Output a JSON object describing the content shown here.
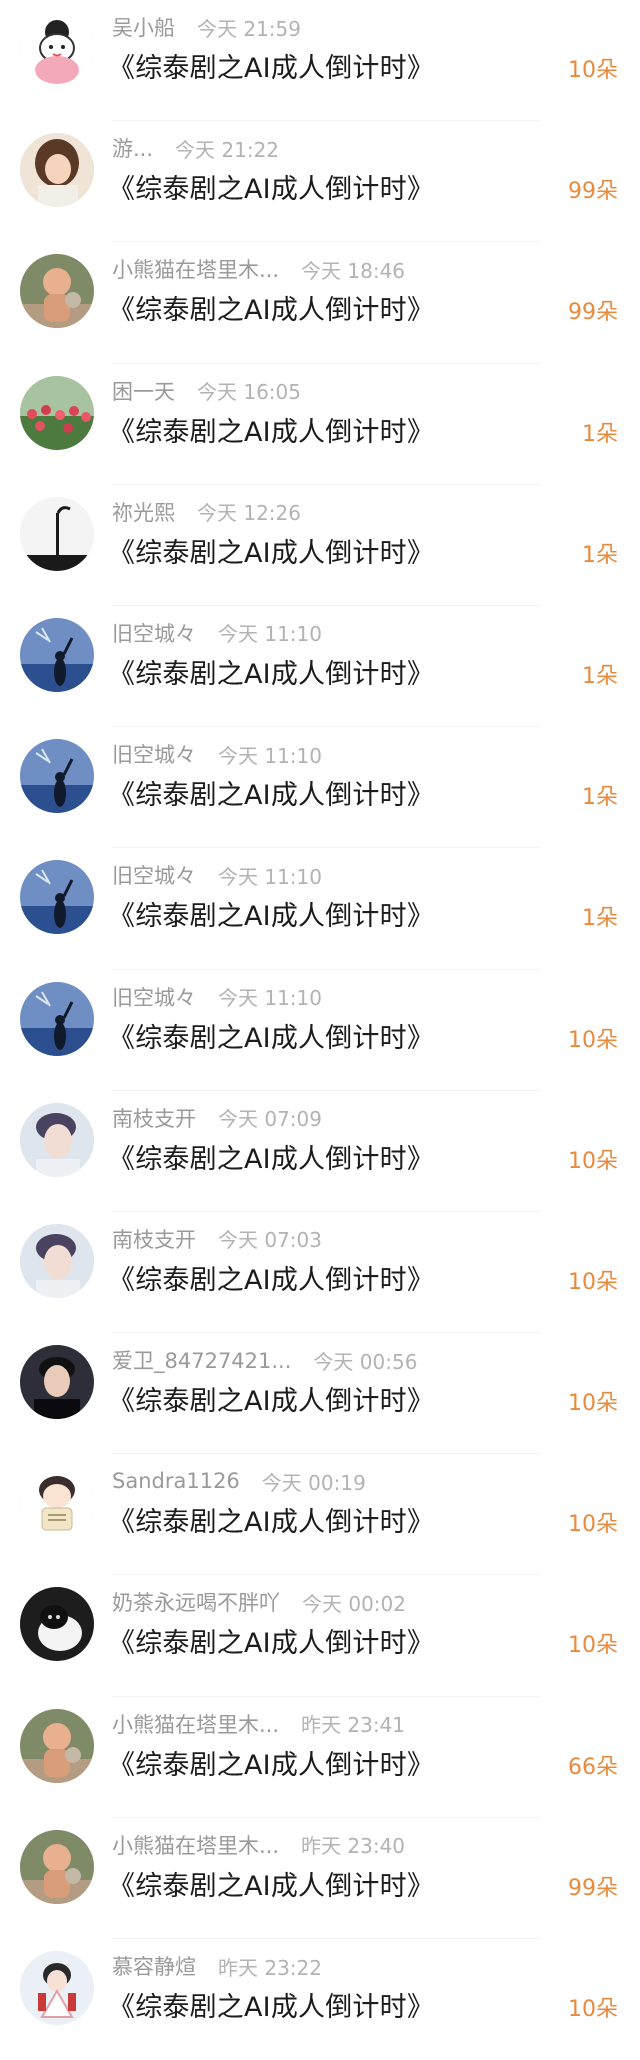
{
  "items": [
    {
      "name": "吴小船",
      "time": "今天 21:59",
      "title": "《综泰剧之AI成人倒计时》",
      "gift": "10朵",
      "avatar": "cartoon-girl-avatar"
    },
    {
      "name": "游...",
      "time": "今天 21:22",
      "title": "《综泰剧之AI成人倒计时》",
      "gift": "99朵",
      "avatar": "girl-portrait-avatar"
    },
    {
      "name": "小熊猫在塔里木...",
      "time": "今天 18:46",
      "title": "《综泰剧之AI成人倒计时》",
      "gift": "99朵",
      "avatar": "child-photo-avatar"
    },
    {
      "name": "困一天",
      "time": "今天 16:05",
      "title": "《综泰剧之AI成人倒计时》",
      "gift": "1朵",
      "avatar": "tulip-field-avatar"
    },
    {
      "name": "祢光熙",
      "time": "今天 12:26",
      "title": "《综泰剧之AI成人倒计时》",
      "gift": "1朵",
      "avatar": "streetlamp-avatar"
    },
    {
      "name": "旧空城々",
      "time": "今天 11:10",
      "title": "《综泰剧之AI成人倒计时》",
      "gift": "1朵",
      "avatar": "blue-sky-silhouette-avatar"
    },
    {
      "name": "旧空城々",
      "time": "今天 11:10",
      "title": "《综泰剧之AI成人倒计时》",
      "gift": "1朵",
      "avatar": "blue-sky-silhouette-avatar"
    },
    {
      "name": "旧空城々",
      "time": "今天 11:10",
      "title": "《综泰剧之AI成人倒计时》",
      "gift": "1朵",
      "avatar": "blue-sky-silhouette-avatar"
    },
    {
      "name": "旧空城々",
      "time": "今天 11:10",
      "title": "《综泰剧之AI成人倒计时》",
      "gift": "10朵",
      "avatar": "blue-sky-silhouette-avatar"
    },
    {
      "name": "南枝支开",
      "time": "今天 07:09",
      "title": "《综泰剧之AI成人倒计时》",
      "gift": "10朵",
      "avatar": "man-portrait-avatar"
    },
    {
      "name": "南枝支开",
      "time": "今天 07:03",
      "title": "《综泰剧之AI成人倒计时》",
      "gift": "10朵",
      "avatar": "man-portrait-avatar"
    },
    {
      "name": "爱卫_84727421...",
      "time": "今天 00:56",
      "title": "《综泰剧之AI成人倒计时》",
      "gift": "10朵",
      "avatar": "dark-portrait-avatar"
    },
    {
      "name": "Sandra1126",
      "time": "今天 00:19",
      "title": "《综泰剧之AI成人倒计时》",
      "gift": "10朵",
      "avatar": "chibi-boy-avatar"
    },
    {
      "name": "奶茶永远喝不胖吖",
      "time": "今天 00:02",
      "title": "《综泰剧之AI成人倒计时》",
      "gift": "10朵",
      "avatar": "black-white-cat-avatar"
    },
    {
      "name": "小熊猫在塔里木...",
      "time": "昨天 23:41",
      "title": "《综泰剧之AI成人倒计时》",
      "gift": "66朵",
      "avatar": "child-photo-avatar"
    },
    {
      "name": "小熊猫在塔里木...",
      "time": "昨天 23:40",
      "title": "《综泰剧之AI成人倒计时》",
      "gift": "99朵",
      "avatar": "child-photo-avatar"
    },
    {
      "name": "慕容静煊",
      "time": "昨天 23:22",
      "title": "《综泰剧之AI成人倒计时》",
      "gift": "10朵",
      "avatar": "girl-costume-avatar"
    }
  ],
  "colors": {
    "gift": "#e88a3d",
    "name": "#9a9a9a",
    "time": "#b3b3b3",
    "title": "#1c1c1c"
  }
}
